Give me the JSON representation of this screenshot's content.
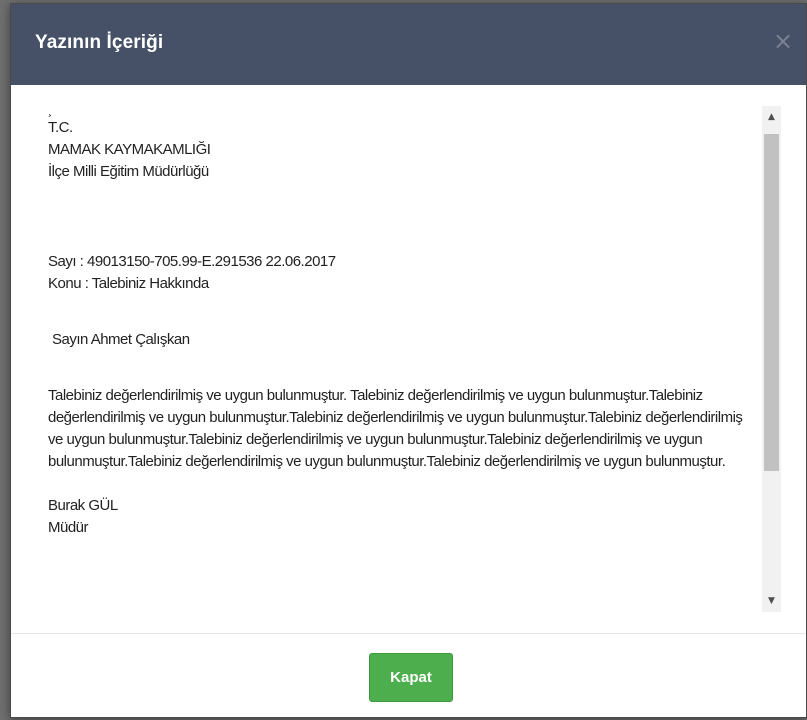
{
  "modal": {
    "title": "Yazının İçeriği",
    "close_label": "×",
    "close_button_label": "Kapat"
  },
  "letter": {
    "top_mark": "¸",
    "header_lines": [
      "T.C.",
      "MAMAK KAYMAKAMLIĞI",
      "İlçe Milli Eğitim Müdürlüğü"
    ],
    "sayi": "Sayı : 49013150-705.99-E.291536 22.06.2017",
    "konu": "Konu : Talebiniz Hakkında",
    "salutation": "Sayın Ahmet Çalışkan",
    "body": "Talebiniz değerlendirilmiş ve uygun bulunmuştur. Talebiniz değerlendirilmiş ve uygun bulunmuştur.Talebiniz değerlendirilmiş ve uygun bulunmuştur.Talebiniz değerlendirilmiş ve uygun bulunmuştur.Talebiniz değerlendirilmiş ve uygun bulunmuştur.Talebiniz değerlendirilmiş ve uygun bulunmuştur.Talebiniz değerlendirilmiş ve uygun bulunmuştur.Talebiniz değerlendirilmiş ve uygun bulunmuştur.Talebiniz değerlendirilmiş ve uygun bulunmuştur.",
    "signer_name": "Burak GÜL",
    "signer_title": "Müdür"
  },
  "scrollbar": {
    "up_arrow": "▲",
    "down_arrow": "▼"
  },
  "colors": {
    "header_bg": "#465066",
    "button_bg": "#4cae4c",
    "close_icon": "#7b8293"
  },
  "icons": [
    "close-icon",
    "scroll-up-arrow-icon",
    "scroll-down-arrow-icon"
  ]
}
